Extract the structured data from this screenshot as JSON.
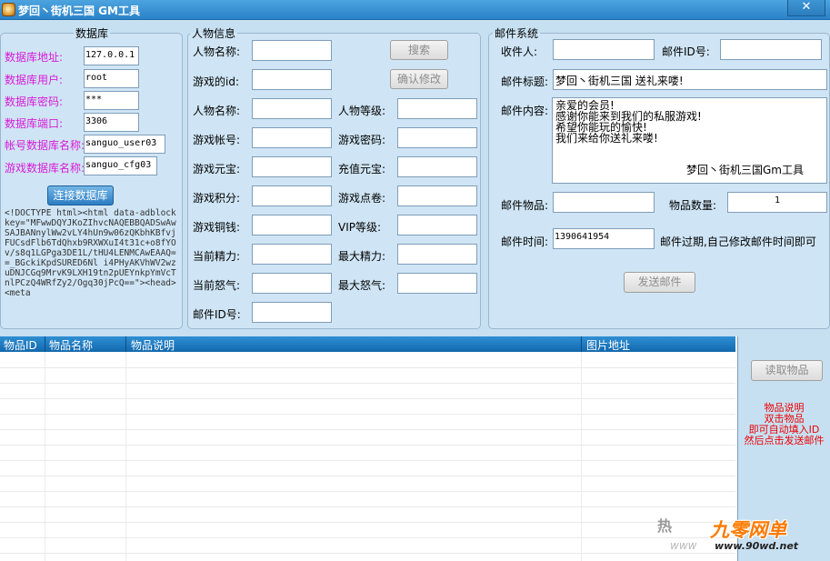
{
  "window": {
    "title": "梦回丶街机三国 GM工具",
    "close": "✕"
  },
  "db": {
    "legend": "数据库",
    "fields": [
      {
        "label": "数据库地址:",
        "value": "127.0.0.1"
      },
      {
        "label": "数据库用户:",
        "value": "root"
      },
      {
        "label": "数据库密码:",
        "value": "***"
      },
      {
        "label": "数据库端口:",
        "value": "3306"
      },
      {
        "label": "帐号数据库名称:",
        "value": "sanguo_user03"
      },
      {
        "label": "游戏数据库名称:",
        "value": "sanguo_cfg03"
      }
    ],
    "connect_button": "连接数据库",
    "html_dump": "<!DOCTYPE html><html data-adblockkey=\"MFwwDQYJKoZIhvcNAQEBBQADSwAwSAJBANnylWw2vLY4hUn9w06zQKbhKBfvjFUCsdFlb6TdQhxb9RXWXuI4t31c+o8fYOv/s8q1LGPga3DE1L/tHU4LENMCAwEAAQ==_BGckiKpdSURED6Nl i4PHyAKVhWV2wzuDNJCGq9MrvK9LXH19tn2pUEYnkpYmVcTnlPCzQ4WRfZy2/Ogq30jPcQ==\"><head><meta"
  },
  "role": {
    "legend": "人物信息",
    "search_button": "搜索",
    "confirm_button": "确认修改",
    "left_fields": [
      "人物名称:",
      "游戏的id:",
      "人物名称:",
      "游戏帐号:",
      "游戏元宝:",
      "游戏积分:",
      "游戏铜钱:",
      "当前精力:",
      "当前怒气:",
      "邮件ID号:"
    ],
    "right_fields": [
      "人物等级:",
      "游戏密码:",
      "充值元宝:",
      "游戏点卷:",
      "VIP等级:",
      "最大精力:",
      "最大怒气:"
    ]
  },
  "mail": {
    "legend": "邮件系统",
    "recipient_label": "收件人:",
    "mail_id_label": "邮件ID号:",
    "subject_label": "邮件标题:",
    "subject_value": "梦回丶街机三国 送礼来喽!",
    "content_label": "邮件内容:",
    "content_lines": [
      "亲爱的会员!",
      "感谢你能来到我们的私服游戏!",
      "希望你能玩的愉快!",
      "我们来给你送礼来喽!"
    ],
    "signature": "梦回丶街机三国Gm工具",
    "item_label": "邮件物品:",
    "qty_label": "物品数量:",
    "qty_value": "1",
    "time_label": "邮件时间:",
    "time_value": "1390641954",
    "time_hint": "邮件过期,自己修改邮件时间即可",
    "send_button": "发送邮件"
  },
  "grid": {
    "columns": [
      "物品ID",
      "物品名称",
      "物品说明",
      "图片地址"
    ]
  },
  "side": {
    "read_button": "读取物品",
    "help_lines": [
      "物品说明",
      "双击物品",
      "即可自动填入ID",
      "然后点击发送邮件"
    ]
  },
  "watermark": {
    "hot": "热",
    "logo_text": "九零网单",
    "logo_url": "www.90wd.net",
    "url": "www"
  },
  "colors": {
    "background": "#c6e0f2",
    "label_magenta": "#d81ad8",
    "help_red": "#ee0000",
    "grid_header": "#1a74bb",
    "titlebar": "#3a92d4"
  }
}
